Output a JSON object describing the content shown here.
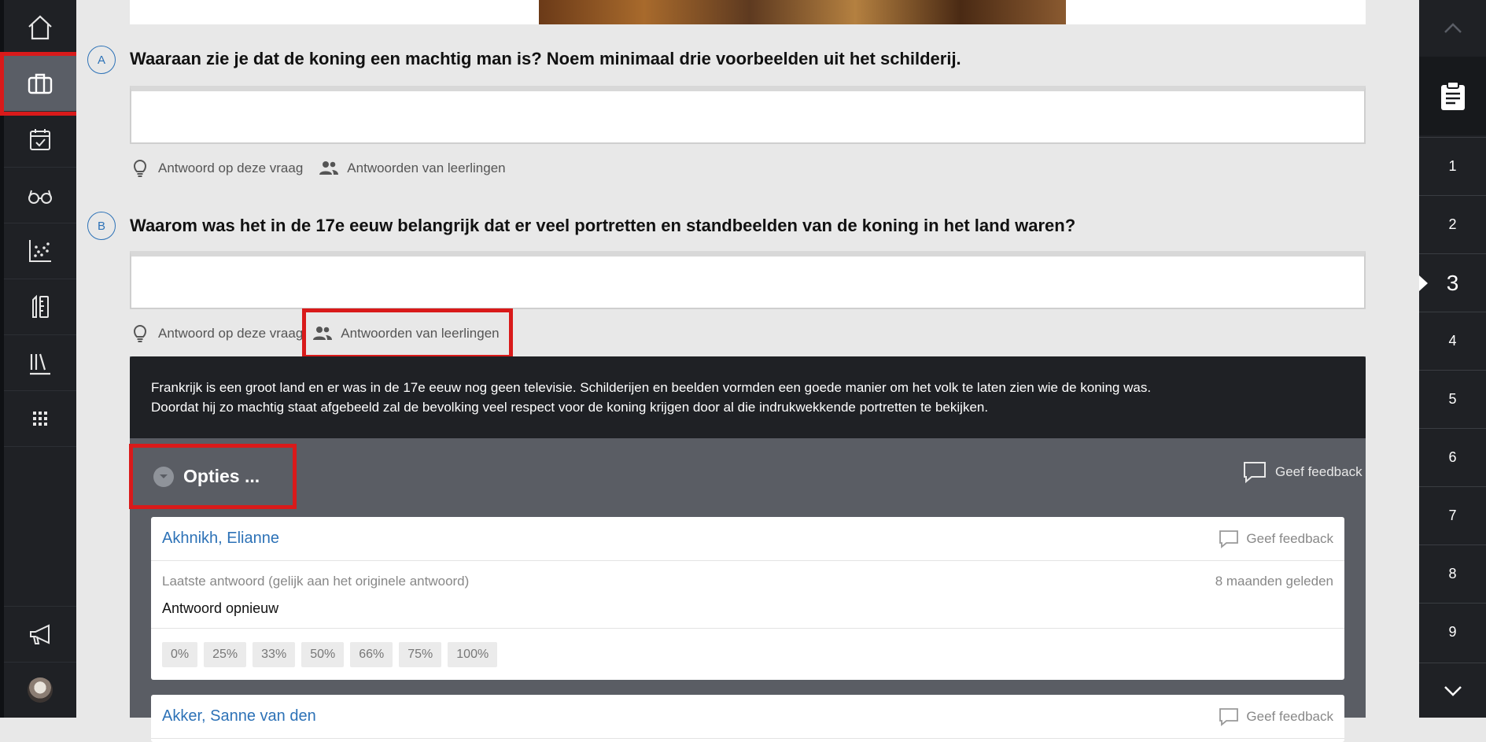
{
  "questions": [
    {
      "letter": "A",
      "title": "Waaraan zie je dat de koning een machtig man is? Noem minimaal drie voorbeelden uit het schilderij.",
      "answer_link": "Antwoord op deze vraag",
      "students_link": "Antwoorden van leerlingen"
    },
    {
      "letter": "B",
      "title": "Waarom was het in de 17e eeuw belangrijk dat er veel portretten en standbeelden van de koning in het land waren?",
      "answer_link": "Antwoord op deze vraag",
      "students_link": "Antwoorden van leerlingen"
    }
  ],
  "model_answer": {
    "line1": "Frankrijk is een groot land en er was in de 17e eeuw nog geen televisie. Schilderijen en beelden vormden een goede manier om het volk te laten zien wie de koning was.",
    "line2": "Doordat hij zo machtig staat afgebeeld zal de bevolking veel respect voor de koning krijgen door al die indrukwekkende portretten te bekijken."
  },
  "options": {
    "label": "Opties ..."
  },
  "class_feedback": "Geef feedback aan de klas",
  "students": [
    {
      "name": "Akhnikh, Elianne",
      "feedback": "Geef feedback",
      "meta": "Laatste antwoord (gelijk aan het originele antwoord)",
      "time": "8 maanden geleden",
      "answer": "Antwoord opnieuw",
      "scores": [
        "0%",
        "25%",
        "33%",
        "50%",
        "66%",
        "75%",
        "100%"
      ]
    },
    {
      "name": "Akker, Sanne van den",
      "feedback": "Geef feedback"
    }
  ],
  "qnav": {
    "items": [
      "1",
      "2",
      "3",
      "4",
      "5",
      "6",
      "7",
      "8",
      "9"
    ],
    "current": "3"
  },
  "colors": {
    "accent": "#2d72b7",
    "highlight": "#d91a1a",
    "sidebar": "#1f2125"
  }
}
